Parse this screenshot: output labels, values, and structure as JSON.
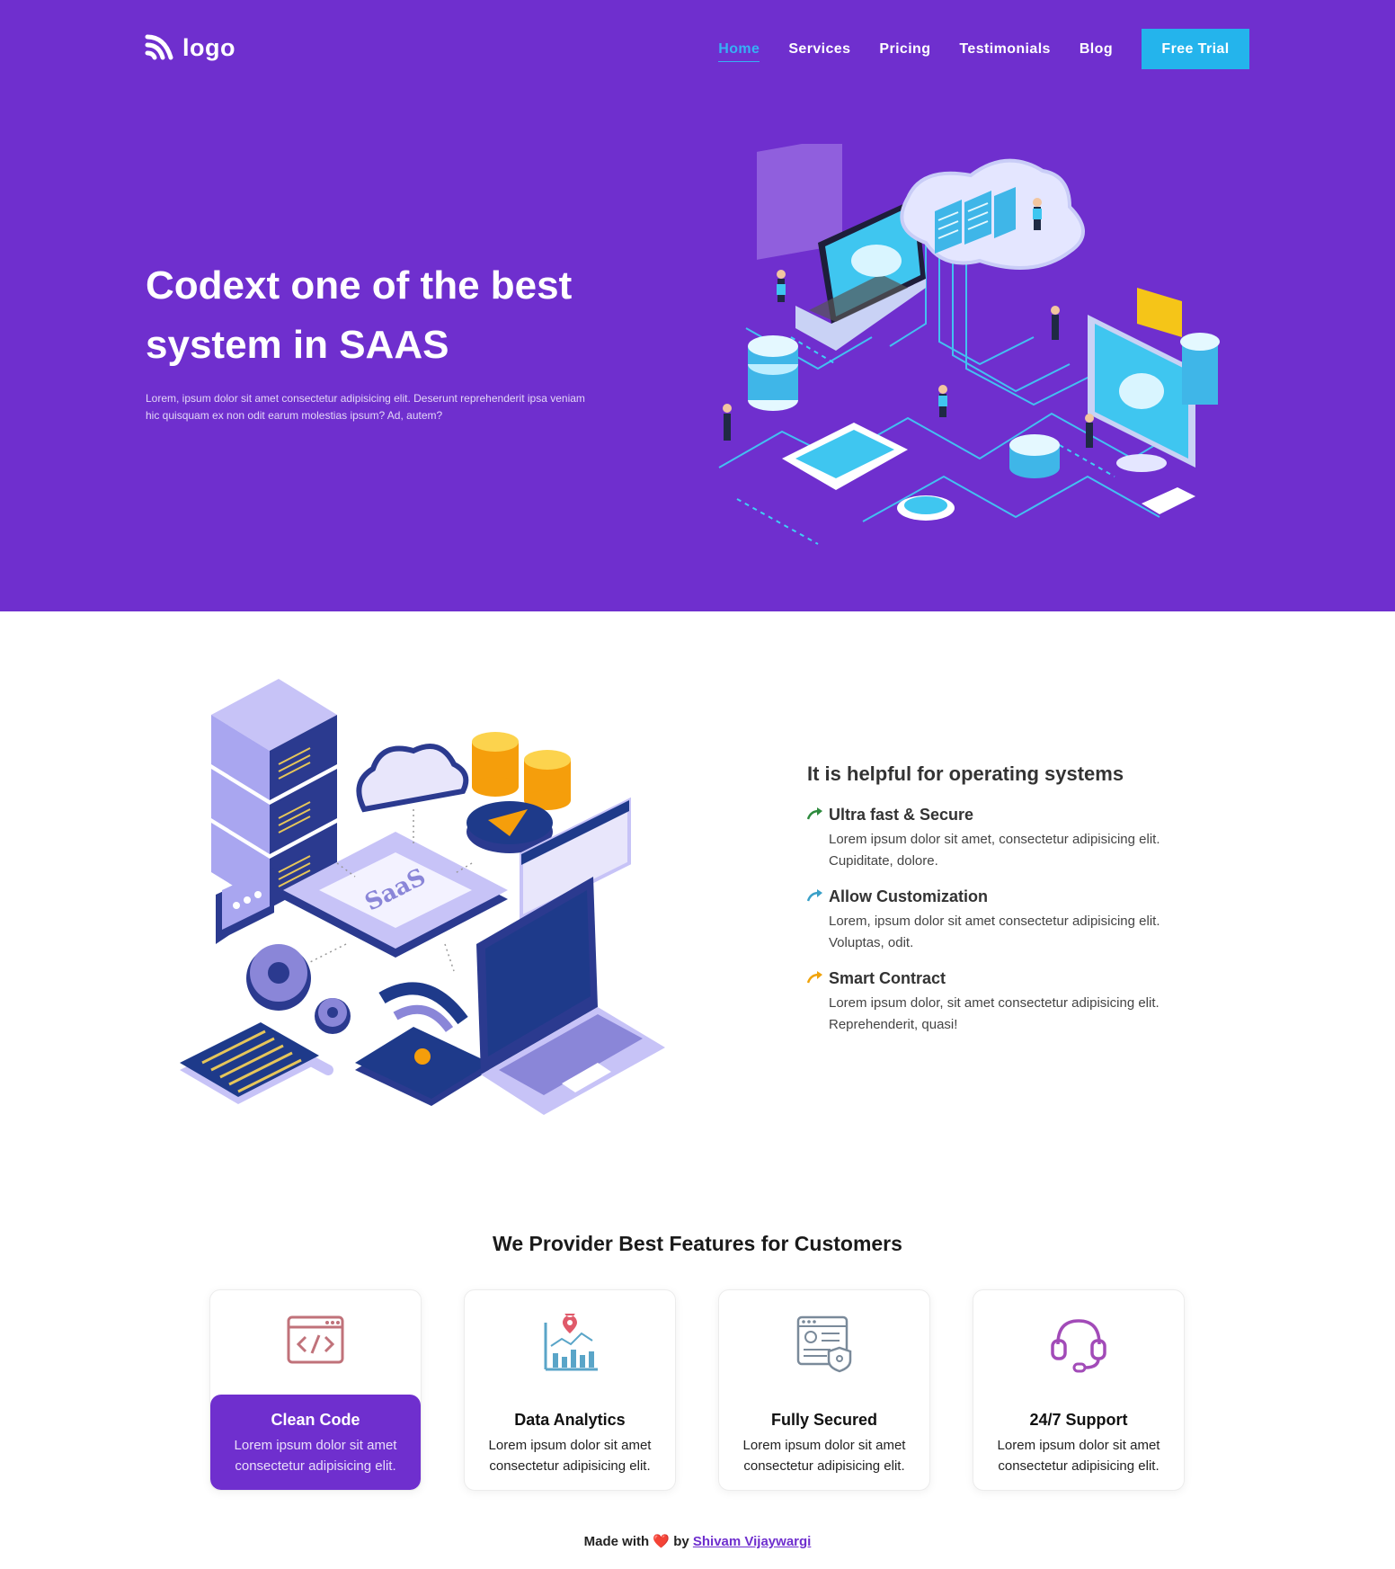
{
  "header": {
    "logo_text": "logo",
    "nav": [
      "Home",
      "Services",
      "Pricing",
      "Testimonials",
      "Blog"
    ],
    "active_nav": "Home",
    "cta_label": "Free Trial"
  },
  "hero": {
    "title": "Codext one of the best system in SAAS",
    "description": "Lorem, ipsum dolor sit amet consectetur adipisicing elit. Deserunt reprehenderit ipsa veniam hic quisquam ex non odit earum molestias ipsum? Ad, autem?"
  },
  "section2": {
    "art_label": "SaaS",
    "title": "It is helpful for operating systems",
    "items": [
      {
        "name": "Ultra fast & Secure",
        "desc": "Lorem ipsum dolor sit amet, consectetur adipisicing elit. Cupiditate, dolore.",
        "arrow_color": "#2e8b3e"
      },
      {
        "name": "Allow Customization",
        "desc": "Lorem, ipsum dolor sit amet consectetur adipisicing elit. Voluptas, odit.",
        "arrow_color": "#3aa0c8"
      },
      {
        "name": "Smart Contract",
        "desc": "Lorem ipsum dolor, sit amet consectetur adipisicing elit. Reprehenderit, quasi!",
        "arrow_color": "#f0a30a"
      }
    ]
  },
  "features": {
    "heading": "We Provider Best Features for Customers",
    "cards": [
      {
        "title": "Clean Code",
        "desc": "Lorem ipsum dolor sit amet consectetur adipisicing elit.",
        "icon": "code-window-icon"
      },
      {
        "title": "Data Analytics",
        "desc": "Lorem ipsum dolor sit amet consectetur adipisicing elit.",
        "icon": "analytics-chart-icon"
      },
      {
        "title": "Fully Secured",
        "desc": "Lorem ipsum dolor sit amet consectetur adipisicing elit.",
        "icon": "secure-document-icon"
      },
      {
        "title": "24/7 Support",
        "desc": "Lorem ipsum dolor sit amet consectetur adipisicing elit.",
        "icon": "headset-icon"
      }
    ]
  },
  "footer": {
    "prefix": "Made with",
    "heart": "❤️",
    "by": "by",
    "author": "Shivam Vijaywargi"
  },
  "colors": {
    "brand": "#6f2fce",
    "cta": "#24b4ec",
    "active_nav": "#36b0f5"
  }
}
